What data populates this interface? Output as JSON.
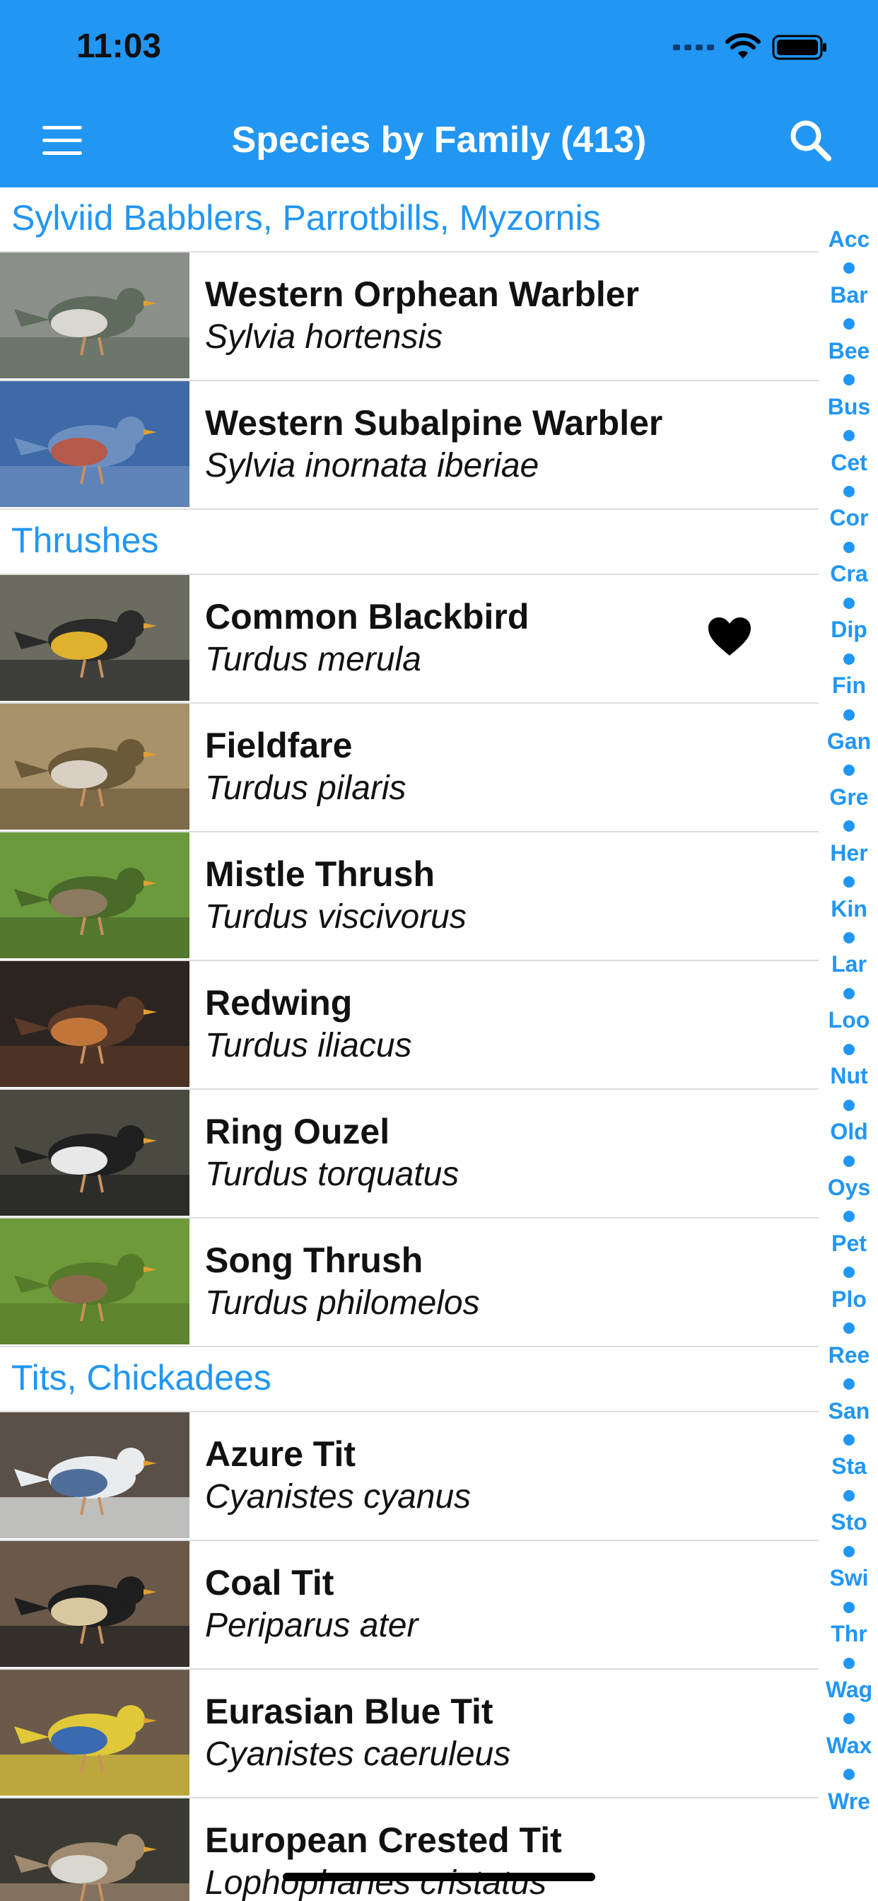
{
  "status": {
    "time": "11:03"
  },
  "header": {
    "title": "Species by Family (413)"
  },
  "colors": {
    "accent": "#2196f3"
  },
  "sections": [
    {
      "title": "Sylviid Babblers, Parrotbills, Myzornis",
      "items": [
        {
          "common": "Western Orphean Warbler",
          "latin": "Sylvia hortensis",
          "favorite": false
        },
        {
          "common": "Western Subalpine Warbler",
          "latin": "Sylvia inornata iberiae",
          "favorite": false
        }
      ]
    },
    {
      "title": "Thrushes",
      "items": [
        {
          "common": "Common Blackbird",
          "latin": "Turdus merula",
          "favorite": true
        },
        {
          "common": "Fieldfare",
          "latin": "Turdus pilaris",
          "favorite": false
        },
        {
          "common": "Mistle Thrush",
          "latin": "Turdus viscivorus",
          "favorite": false
        },
        {
          "common": "Redwing",
          "latin": "Turdus iliacus",
          "favorite": false
        },
        {
          "common": "Ring Ouzel",
          "latin": "Turdus torquatus",
          "favorite": false
        },
        {
          "common": "Song Thrush",
          "latin": "Turdus philomelos",
          "favorite": false
        }
      ]
    },
    {
      "title": "Tits, Chickadees",
      "items": [
        {
          "common": "Azure Tit",
          "latin": "Cyanistes cyanus",
          "favorite": false
        },
        {
          "common": "Coal Tit",
          "latin": "Periparus ater",
          "favorite": false
        },
        {
          "common": "Eurasian Blue Tit",
          "latin": "Cyanistes caeruleus",
          "favorite": false
        },
        {
          "common": "European Crested Tit",
          "latin": "Lophophanes cristatus",
          "favorite": false
        }
      ]
    }
  ],
  "index": [
    "Acc",
    "Bar",
    "Bee",
    "Bus",
    "Cet",
    "Cor",
    "Cra",
    "Dip",
    "Fin",
    "Gan",
    "Gre",
    "Her",
    "Kin",
    "Lar",
    "Loo",
    "Nut",
    "Old",
    "Oys",
    "Pet",
    "Plo",
    "Ree",
    "San",
    "Sta",
    "Sto",
    "Swi",
    "Thr",
    "Wag",
    "Wax",
    "Wre"
  ]
}
